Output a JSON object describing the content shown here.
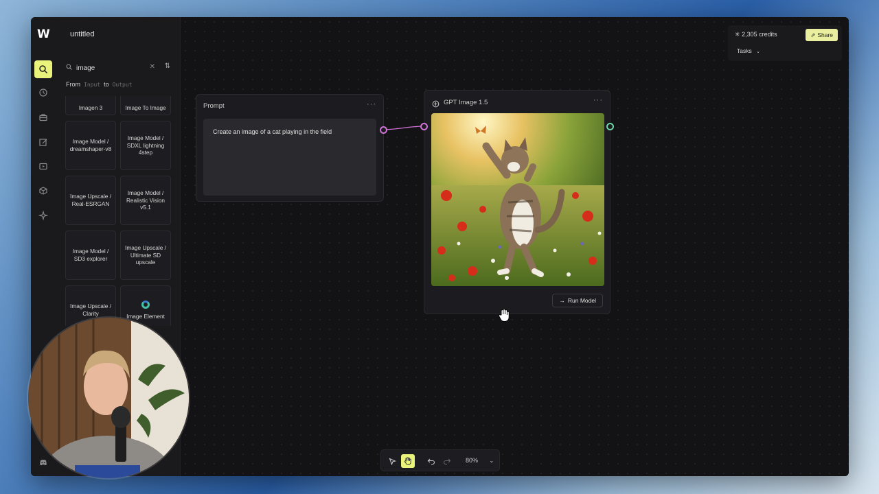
{
  "app": {
    "title": "untitled"
  },
  "rail": {
    "items": [
      "search-icon",
      "history-icon",
      "toolbox-icon",
      "edit-image-icon",
      "video-icon",
      "cube-icon",
      "sparkle-icon"
    ],
    "active": "search-icon",
    "bottom": "discord-icon"
  },
  "search": {
    "value": "image",
    "from_label": "From",
    "from_chip": "Input",
    "to_label": "to",
    "to_chip": "Output"
  },
  "models": [
    "Imagen 3",
    "Image To Image",
    "Image Model / dreamshaper-v8",
    "Image Model / SDXL lightning 4step",
    "Image Upscale / Real-ESRGAN",
    "Image Model / Realistic Vision v5.1",
    "Image Model / SD3 explorer",
    "Image Upscale / Ultimate SD upscale",
    "Image Upscale / Clarity",
    "Image Element"
  ],
  "prompt_node": {
    "title": "Prompt",
    "text": "Create an image of a cat playing in the field"
  },
  "model_node": {
    "title": "GPT Image 1.5",
    "run_label": "Run Model"
  },
  "header": {
    "credits": "2,305 credits",
    "share": "Share",
    "tasks": "Tasks"
  },
  "toolbar": {
    "zoom": "80%"
  },
  "colors": {
    "accent": "#e9f27a",
    "input_port": "#d072d8",
    "output_port": "#6fd6a8",
    "canvas": "#131316"
  }
}
